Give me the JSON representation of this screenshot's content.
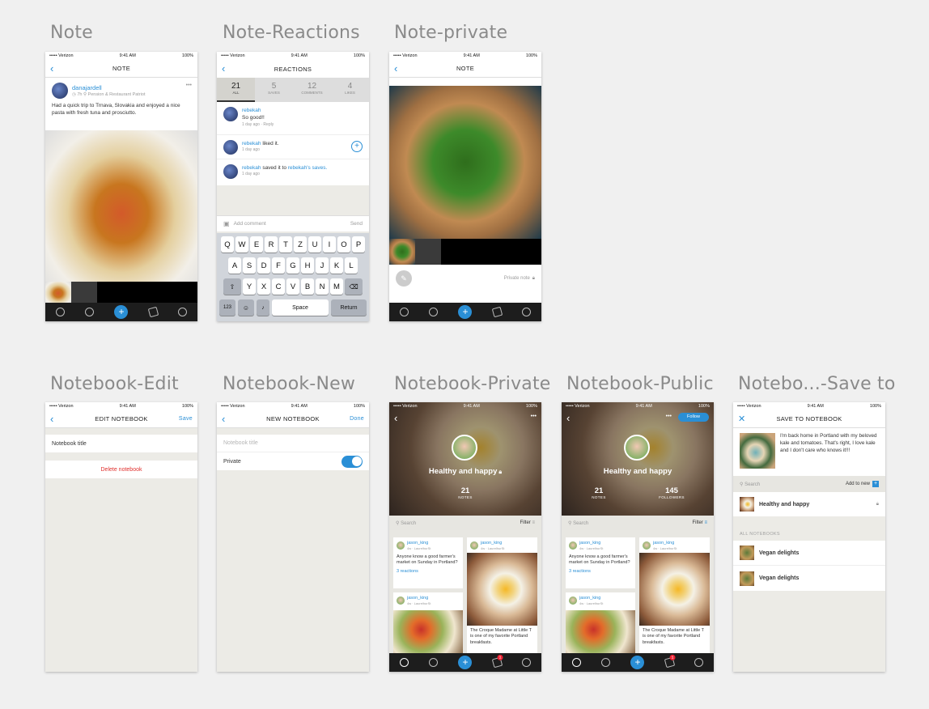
{
  "artboards": {
    "note": "Note",
    "note_reactions": "Note-Reactions",
    "note_private": "Note-private",
    "notebook_edit": "Notebook-Edit",
    "notebook_new": "Notebook-New",
    "notebook_private": "Notebook-Private",
    "notebook_public": "Notebook-Public",
    "notebook_save_to": "Notebo...-Save to"
  },
  "status": {
    "carrier": "••••• Verizon",
    "time": "9:41 AM",
    "battery": "100%"
  },
  "note": {
    "title": "NOTE",
    "author": "danajardell",
    "time": "7h",
    "place": "Pension & Restaurant Patriot",
    "text": "Had a quick trip to Trnava, Slovakia and enjoyed a nice pasta with fresh tuna and prosciutto.",
    "more": "•••"
  },
  "reactions": {
    "title": "REACTIONS",
    "tabs": [
      {
        "count": "21",
        "label": "ALL"
      },
      {
        "count": "5",
        "label": "SAVES"
      },
      {
        "count": "12",
        "label": "COMMENTS"
      },
      {
        "count": "4",
        "label": "LIKES"
      }
    ],
    "items": [
      {
        "user": "rebekah",
        "text": "So good!!",
        "meta": "1 day ago",
        "reply": "Reply"
      },
      {
        "user": "rebekah",
        "text": "liked it.",
        "meta": "1 day ago"
      },
      {
        "user": "rebekah",
        "text": "saved it to",
        "target": "rebekah's saves.",
        "meta": "1 day ago"
      }
    ],
    "comment_placeholder": "Add comment",
    "send": "Send",
    "keys_row1": [
      "Q",
      "W",
      "E",
      "R",
      "T",
      "Z",
      "U",
      "I",
      "O",
      "P"
    ],
    "keys_row2": [
      "A",
      "S",
      "D",
      "F",
      "G",
      "H",
      "J",
      "K",
      "L"
    ],
    "keys_row3": [
      "Y",
      "X",
      "C",
      "V",
      "B",
      "N",
      "M"
    ],
    "key_123": "123",
    "key_space": "Space",
    "key_return": "Return"
  },
  "note_private": {
    "title": "NOTE",
    "private_label": "Private note"
  },
  "notebook_edit": {
    "title": "EDIT NOTEBOOK",
    "save": "Save",
    "field": "Notebook title",
    "delete": "Delete notebook"
  },
  "notebook_new": {
    "title": "NEW NOTEBOOK",
    "done": "Done",
    "placeholder": "Notebook title",
    "private": "Private",
    "private_on": true
  },
  "notebook_private": {
    "name": "Healthy and happy",
    "notes_count": "21",
    "notes_label": "NOTES",
    "search": "Search",
    "filter": "Filter",
    "badge": "2"
  },
  "notebook_public": {
    "name": "Healthy and happy",
    "notes_count": "21",
    "notes_label": "NOTES",
    "followers_count": "145",
    "followers_label": "FOLLOWERS",
    "follow": "Follow",
    "search": "Search",
    "filter": "Filter",
    "badge": "2"
  },
  "feed_cards": {
    "user": "jason_king",
    "meta_time": "4w",
    "meta_place": "LaurelhurSt",
    "question": "Anyone know a good farmer's market on Sunday in Portland?",
    "reactions": "3 reactions",
    "croque": "The Croque Madame at Little T is one of my favorite Portland breakfasts."
  },
  "save_to": {
    "title": "SAVE TO NOTEBOOK",
    "note_text": "I'm back home in Portland with my beloved kale and tomatoes. That's right, I love kale and I don't care who knows it!!!",
    "search": "Search",
    "add_new": "Add to new",
    "current": "Healthy and happy",
    "section": "ALL NOTEBOOKS",
    "notebooks": [
      "Vegan delights",
      "Vegan delights"
    ]
  }
}
